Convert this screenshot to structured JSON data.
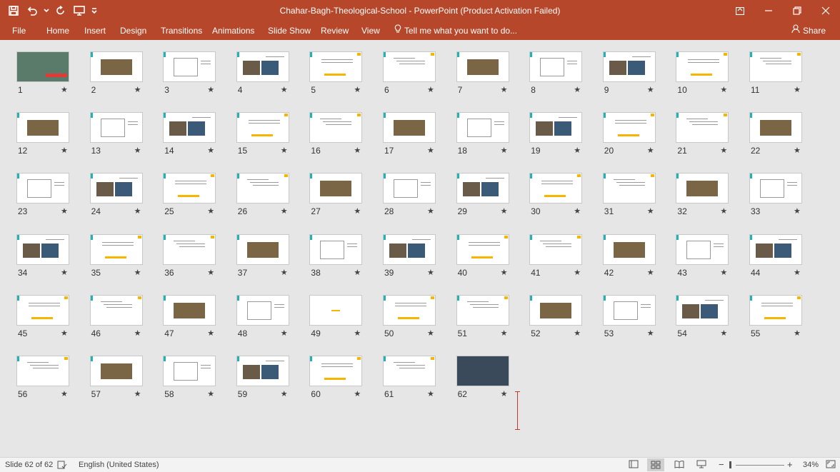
{
  "window": {
    "title": "Chahar-Bagh-Theological-School - PowerPoint (Product Activation Failed)"
  },
  "qat": {
    "save_icon": "save-icon",
    "undo_icon": "undo-icon",
    "redo_icon": "repeat-icon",
    "present_icon": "present-from-beginning-icon",
    "more_icon": "customize-qat-icon"
  },
  "ribbon": {
    "tabs": [
      "File",
      "Home",
      "Insert",
      "Design",
      "Transitions",
      "Animations",
      "Slide Show",
      "Review",
      "View"
    ],
    "tell_me": "Tell me what you want to do...",
    "share": "Share"
  },
  "slides": [
    {
      "n": "1"
    },
    {
      "n": "2"
    },
    {
      "n": "3"
    },
    {
      "n": "4"
    },
    {
      "n": "5"
    },
    {
      "n": "6"
    },
    {
      "n": "7"
    },
    {
      "n": "8"
    },
    {
      "n": "9"
    },
    {
      "n": "10"
    },
    {
      "n": "11"
    },
    {
      "n": "12"
    },
    {
      "n": "13"
    },
    {
      "n": "14"
    },
    {
      "n": "15"
    },
    {
      "n": "16"
    },
    {
      "n": "17"
    },
    {
      "n": "18"
    },
    {
      "n": "19"
    },
    {
      "n": "20"
    },
    {
      "n": "21"
    },
    {
      "n": "22"
    },
    {
      "n": "23"
    },
    {
      "n": "24"
    },
    {
      "n": "25"
    },
    {
      "n": "26"
    },
    {
      "n": "27"
    },
    {
      "n": "28"
    },
    {
      "n": "29"
    },
    {
      "n": "30"
    },
    {
      "n": "31"
    },
    {
      "n": "32"
    },
    {
      "n": "33"
    },
    {
      "n": "34"
    },
    {
      "n": "35"
    },
    {
      "n": "36"
    },
    {
      "n": "37"
    },
    {
      "n": "38"
    },
    {
      "n": "39"
    },
    {
      "n": "40"
    },
    {
      "n": "41"
    },
    {
      "n": "42"
    },
    {
      "n": "43"
    },
    {
      "n": "44"
    },
    {
      "n": "45"
    },
    {
      "n": "46"
    },
    {
      "n": "47"
    },
    {
      "n": "48"
    },
    {
      "n": "49"
    },
    {
      "n": "50"
    },
    {
      "n": "51"
    },
    {
      "n": "52"
    },
    {
      "n": "53"
    },
    {
      "n": "54"
    },
    {
      "n": "55"
    },
    {
      "n": "56"
    },
    {
      "n": "57"
    },
    {
      "n": "58"
    },
    {
      "n": "59"
    },
    {
      "n": "60"
    },
    {
      "n": "61"
    },
    {
      "n": "62"
    }
  ],
  "slide_star": "★",
  "status": {
    "slide_counter": "Slide 62 of 62",
    "language": "English (United States)",
    "zoom": "34%",
    "zoom_minus": "−",
    "zoom_plus": "+"
  },
  "colors": {
    "accent": "#b7472a",
    "teal": "#20b2b5",
    "yellow": "#f7b500"
  }
}
